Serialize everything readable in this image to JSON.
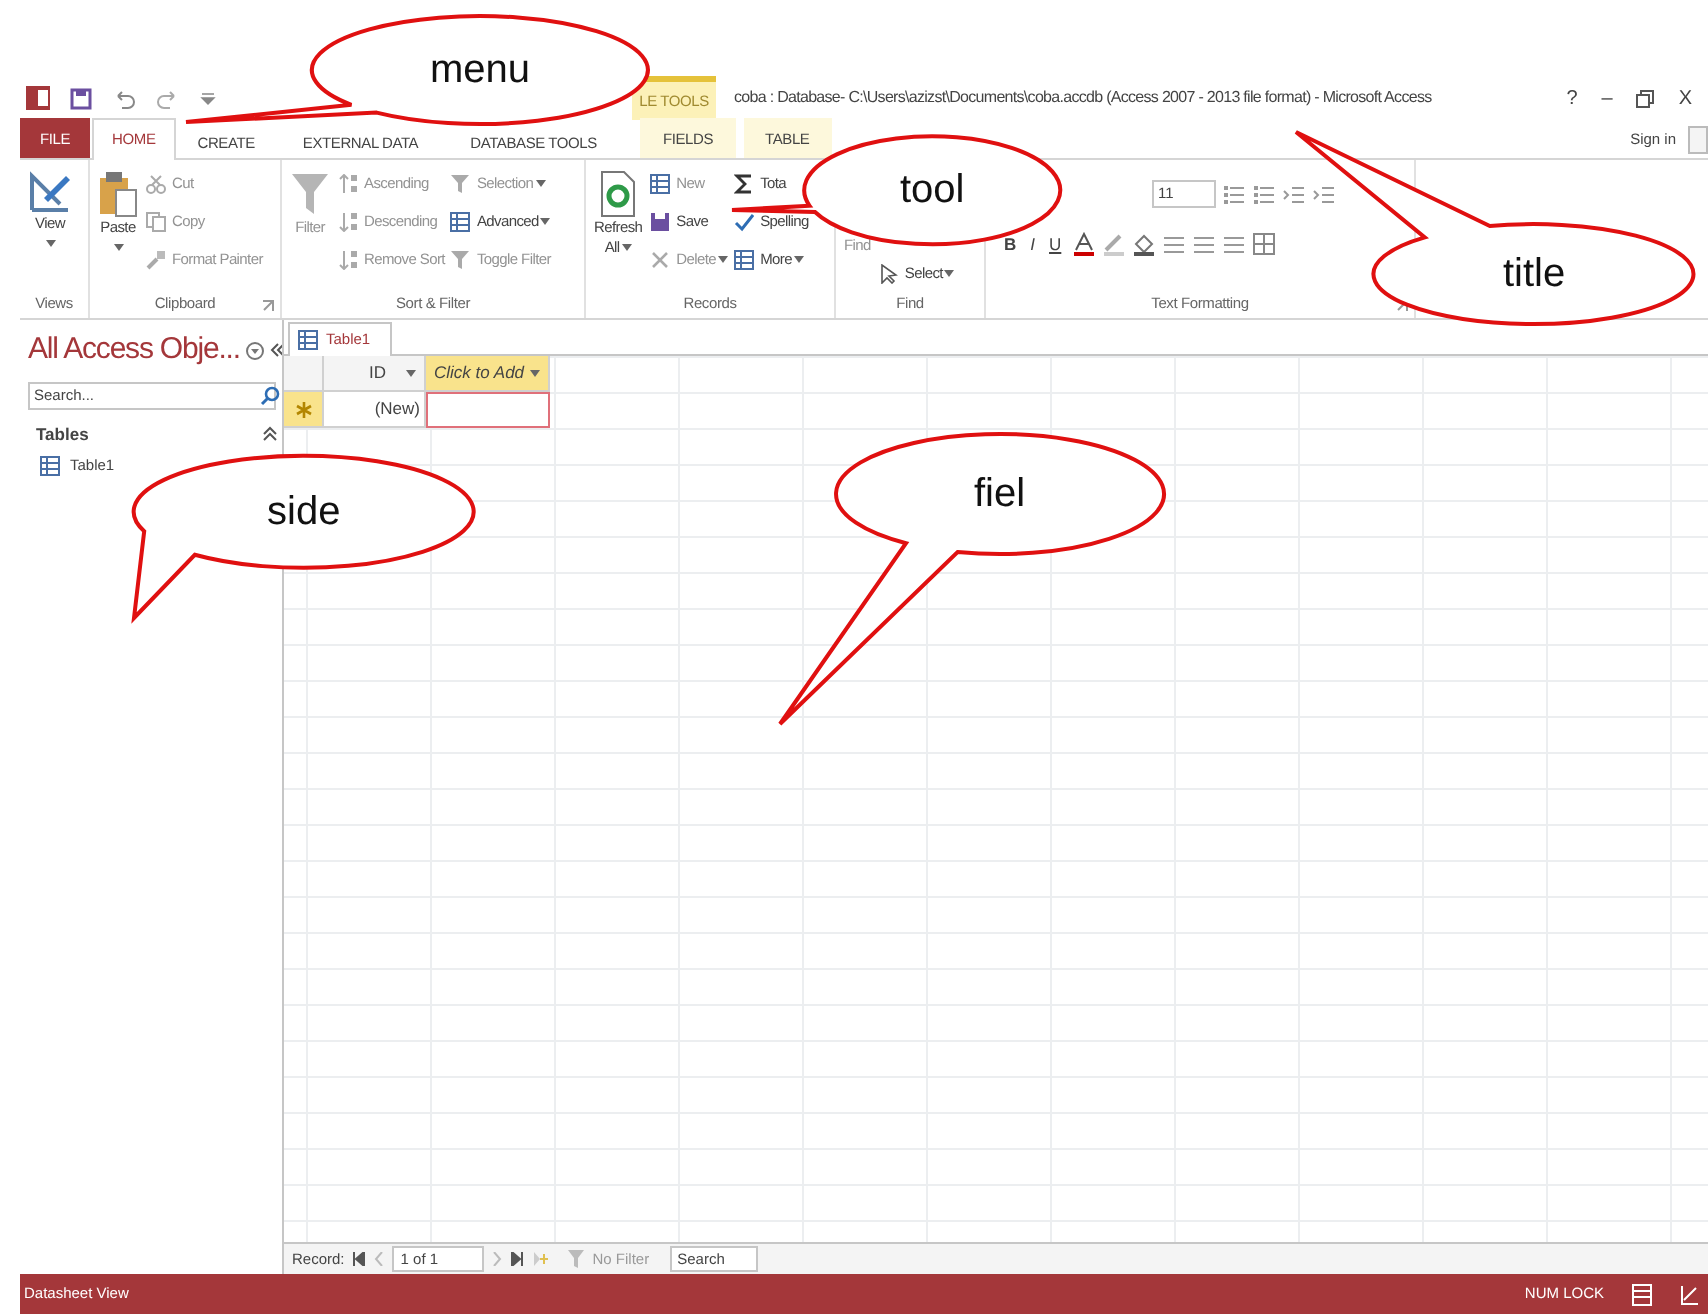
{
  "title_bar": {
    "contextual_header": "LE TOOLS",
    "title": "coba : Database- C:\\Users\\azizst\\Documents\\coba.accdb (Access 2007 - 2013 file format) - Microsoft Access",
    "help": "?",
    "minimize": "–",
    "close": "X"
  },
  "tabs": [
    {
      "label": "FILE",
      "kind": "file",
      "selected": false
    },
    {
      "label": "HOME",
      "kind": "normal",
      "selected": true
    },
    {
      "label": "CREATE",
      "kind": "normal",
      "selected": false
    },
    {
      "label": "EXTERNAL DATA",
      "kind": "normal",
      "selected": false
    },
    {
      "label": "DATABASE TOOLS",
      "kind": "normal",
      "selected": false
    },
    {
      "label": "FIELDS",
      "kind": "contextual",
      "selected": false
    },
    {
      "label": "TABLE",
      "kind": "contextual",
      "selected": false
    }
  ],
  "sign_in": "Sign in",
  "ribbon": [
    {
      "label": "Views",
      "launcher": false,
      "columns": [
        [
          {
            "label": "View",
            "kind": "large",
            "disabled": false,
            "dropdown": true
          }
        ]
      ]
    },
    {
      "label": "Clipboard",
      "launcher": true,
      "columns": [
        [
          {
            "label": "Paste",
            "kind": "large",
            "disabled": false,
            "dropdown": true
          }
        ],
        [
          {
            "label": "Cut",
            "kind": "small",
            "disabled": true,
            "dropdown": false
          },
          {
            "label": "Copy",
            "kind": "small",
            "disabled": true,
            "dropdown": false
          },
          {
            "label": "Format Painter",
            "kind": "small",
            "disabled": true,
            "dropdown": false
          }
        ]
      ]
    },
    {
      "label": "Sort & Filter",
      "launcher": false,
      "columns": [
        [
          {
            "label": "Filter",
            "kind": "large",
            "disabled": true,
            "dropdown": false
          }
        ],
        [
          {
            "label": "Ascending",
            "kind": "small",
            "disabled": true,
            "dropdown": false
          },
          {
            "label": "Descending",
            "kind": "small",
            "disabled": true,
            "dropdown": false
          },
          {
            "label": "Remove Sort",
            "kind": "small",
            "disabled": true,
            "dropdown": false
          }
        ],
        [
          {
            "label": "Selection",
            "kind": "small",
            "disabled": true,
            "dropdown": true
          },
          {
            "label": "Advanced",
            "kind": "small",
            "disabled": false,
            "dropdown": true
          },
          {
            "label": "Toggle Filter",
            "kind": "small",
            "disabled": true,
            "dropdown": false
          }
        ]
      ]
    },
    {
      "label": "Records",
      "launcher": false,
      "columns": [
        [
          {
            "label": "Refresh All",
            "kind": "large",
            "disabled": false,
            "dropdown": true
          }
        ],
        [
          {
            "label": "New",
            "kind": "small",
            "disabled": true,
            "dropdown": false
          },
          {
            "label": "Save",
            "kind": "small",
            "disabled": false,
            "dropdown": false
          },
          {
            "label": "Delete",
            "kind": "small",
            "disabled": true,
            "dropdown": true
          }
        ],
        [
          {
            "label": "Tota",
            "kind": "small",
            "disabled": false,
            "dropdown": false
          },
          {
            "label": "Spelling",
            "kind": "small",
            "disabled": false,
            "dropdown": false
          },
          {
            "label": "More",
            "kind": "small",
            "disabled": false,
            "dropdown": true
          }
        ]
      ]
    },
    {
      "label": "Find",
      "launcher": false,
      "columns": [
        [
          {
            "label": "Find",
            "kind": "large",
            "disabled": true,
            "dropdown": false
          }
        ],
        [
          {
            "label": "Select",
            "kind": "small",
            "disabled": false,
            "dropdown": true
          }
        ]
      ]
    },
    {
      "label": "Text Formatting",
      "launcher": true,
      "rows": [
        [
          {
            "label": "11",
            "kind": "field"
          },
          {
            "kind": "icon"
          },
          {
            "kind": "icon"
          },
          {
            "kind": "icon"
          },
          {
            "kind": "icon"
          }
        ],
        [
          {
            "label": "B",
            "kind": "glyph"
          },
          {
            "label": "I",
            "kind": "glyph"
          },
          {
            "label": "U",
            "kind": "glyph"
          },
          {
            "kind": "icon"
          },
          {
            "kind": "icon"
          },
          {
            "kind": "icon"
          },
          {
            "kind": "icon"
          },
          {
            "kind": "icon"
          },
          {
            "kind": "icon"
          },
          {
            "kind": "icon"
          }
        ]
      ]
    }
  ],
  "nav_pane": {
    "title": "All Access Obje...",
    "search": {
      "placeholder": "Search..."
    },
    "section": "Tables",
    "expanded": true,
    "items": [
      {
        "label": "Table1"
      }
    ]
  },
  "document_tab": {
    "label": "Table1"
  },
  "datasheet": {
    "columns": [
      {
        "label": "ID",
        "kind": "field"
      },
      {
        "label": "Click to Add",
        "kind": "add"
      }
    ],
    "rows": [
      {
        "new": true,
        "cells": [
          {
            "text": "(New)",
            "focused": false
          },
          {
            "focused": true
          }
        ]
      }
    ]
  },
  "record_nav": {
    "label": "Record:",
    "position": "1 of 1",
    "filter": "No Filter",
    "search": "Search"
  },
  "status_bar": {
    "view": "Datasheet View",
    "indicator": "NUM LOCK"
  },
  "callouts": [
    {
      "text": "menu"
    },
    {
      "text": "tool"
    },
    {
      "text": "title"
    },
    {
      "text": "side"
    },
    {
      "text": "fiel"
    }
  ]
}
